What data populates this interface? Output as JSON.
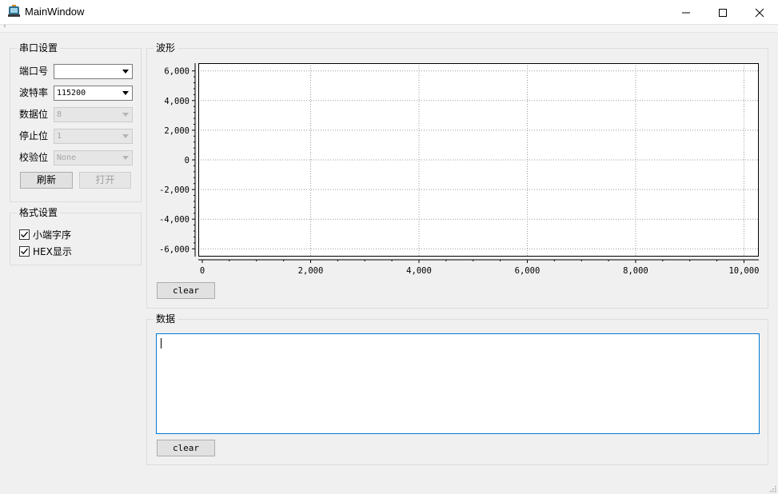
{
  "window": {
    "title": "MainWindow",
    "icon": "app-icon",
    "controls": [
      "minimize-icon",
      "maximize-icon",
      "close-icon"
    ],
    "menu_glyph": "‹"
  },
  "serial": {
    "group_title": "串口设置",
    "port_label": "端口号",
    "port_value": "",
    "baud_label": "波特率",
    "baud_value": "115200",
    "databits_label": "数据位",
    "databits_value": "8",
    "stopbits_label": "停止位",
    "stopbits_value": "1",
    "parity_label": "校验位",
    "parity_value": "None",
    "refresh_label": "刷新",
    "open_label": "打开"
  },
  "format": {
    "group_title": "格式设置",
    "little_endian_label": "小端字序",
    "little_endian_checked": true,
    "hex_label": "HEX显示",
    "hex_checked": true
  },
  "waveform": {
    "group_title": "波形",
    "clear_label": "clear"
  },
  "chart_data": {
    "type": "line",
    "title": "",
    "xlabel": "",
    "ylabel": "",
    "xlim": [
      0,
      10200
    ],
    "ylim": [
      -6200,
      6200
    ],
    "x_ticks": [
      0,
      2000,
      4000,
      6000,
      8000,
      10000
    ],
    "x_tick_labels": [
      "0",
      "2,000",
      "4,000",
      "6,000",
      "8,000",
      "10,000"
    ],
    "y_ticks": [
      6000,
      4000,
      2000,
      0,
      -2000,
      -4000,
      -6000
    ],
    "y_tick_labels": [
      "6,000",
      "4,000",
      "2,000",
      "0",
      "-2,000",
      "-4,000",
      "-6,000"
    ],
    "grid": true,
    "series": []
  },
  "data_panel": {
    "group_title": "数据",
    "text": "",
    "clear_label": "clear"
  },
  "colors": {
    "focus_border": "#0078d7",
    "window_bg": "#f0f0f0"
  }
}
